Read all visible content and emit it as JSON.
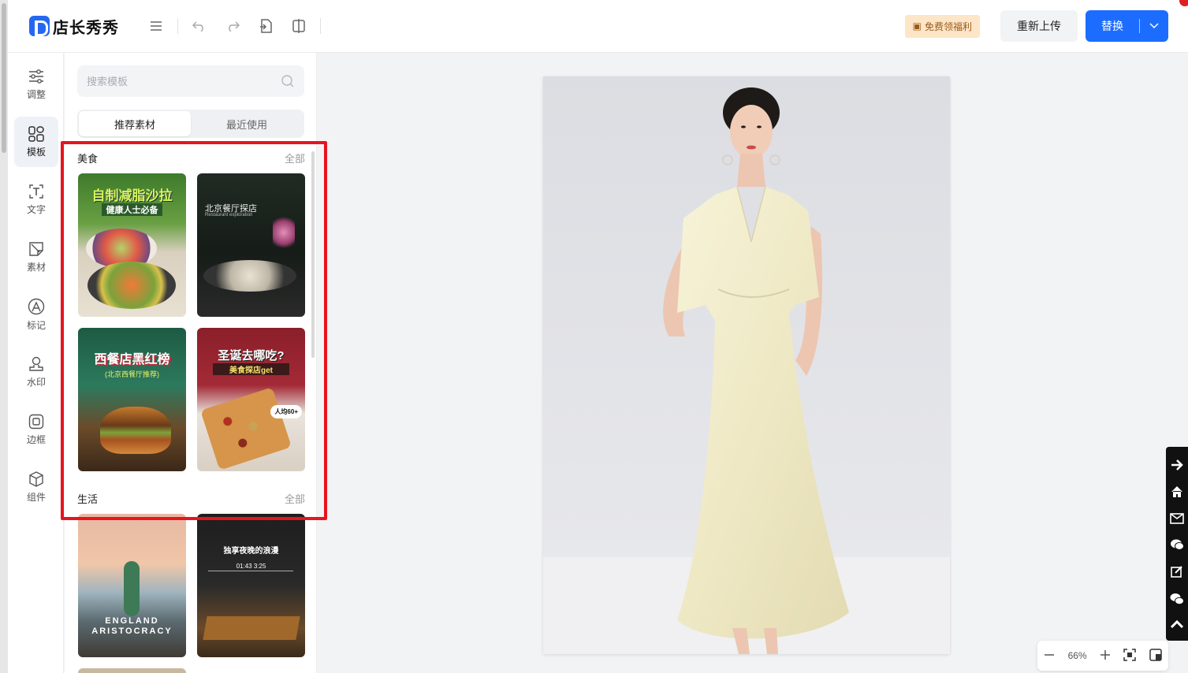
{
  "header": {
    "logo_text": "店长秀秀",
    "promo_label": "免费领福利",
    "reupload_label": "重新上传",
    "replace_label": "替换"
  },
  "sidebar": {
    "items": [
      {
        "label": "调整",
        "icon": "sliders-icon"
      },
      {
        "label": "模板",
        "icon": "template-grid-icon"
      },
      {
        "label": "文字",
        "icon": "text-icon"
      },
      {
        "label": "素材",
        "icon": "sticker-icon"
      },
      {
        "label": "标记",
        "icon": "marker-icon"
      },
      {
        "label": "水印",
        "icon": "watermark-icon"
      },
      {
        "label": "边框",
        "icon": "frame-icon"
      },
      {
        "label": "组件",
        "icon": "component-icon"
      }
    ]
  },
  "panel": {
    "search_placeholder": "搜索模板",
    "tabs": [
      "推荐素材",
      "最近使用"
    ],
    "sections": [
      {
        "title": "美食",
        "all_label": "全部",
        "templates": [
          {
            "caption": "自制减脂沙拉",
            "subcaption": "健康人士必备"
          },
          {
            "caption": "北京餐厅探店",
            "subcaption": "Restaurant exploration"
          },
          {
            "caption": "西餐店黑红榜",
            "subcaption": "(北京西餐厅推荐)"
          },
          {
            "caption": "圣诞去哪吃?",
            "subcaption": "美食探店get",
            "badge": "人均60+"
          }
        ]
      },
      {
        "title": "生活",
        "all_label": "全部",
        "templates": [
          {
            "caption": "ENGLAND ARISTOCRACY",
            "subcaption": ""
          },
          {
            "caption": "独享夜晚的浪漫",
            "subcaption": "01:43    3:25"
          }
        ]
      }
    ]
  },
  "zoom": {
    "level": "66%"
  },
  "colors": {
    "primary": "#1c6dff",
    "highlight": "#e8141e",
    "promo_bg": "#fde5c8"
  }
}
